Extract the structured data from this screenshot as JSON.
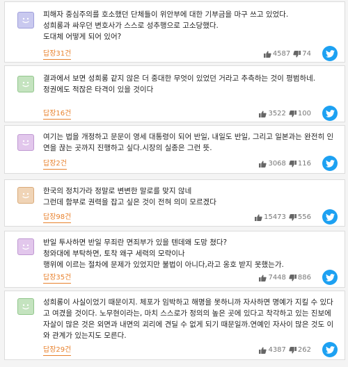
{
  "comments": [
    {
      "text": "피해자 중심주의를 호소했던 단체들이 위안부에 대한 기부금을 마구 쓰고 있었다.\n성희롱과 싸우던 변호사가 스스로 성추행으로 고소당했다.\n도대체 어떻게 되어 있어?",
      "reply": "답장31건",
      "likes": "4587",
      "dislikes": "74",
      "avatar_color": "#c9c9ef",
      "avatar_border": "#9f9fdb"
    },
    {
      "text": "결과에서 보면 성희롱 같지 않은 더 중대한 무엇이 있었던 거라고 추측하는 것이 평범하네.\n정권에도 적잖은 타격이 있을 것이다",
      "reply": "답장16건",
      "likes": "3522",
      "dislikes": "100",
      "avatar_color": "#c4e3bf",
      "avatar_border": "#92c68c"
    },
    {
      "text": "여기는 법을 개정하고 문문이 영세 대통령이 되어 반일, 내일도 반일, 그리고 일본과는 완전히 인연을 끊는 곳까지 진행하고 싶다.시장의 실종은 그런 뜻.",
      "reply": "답장2건",
      "likes": "3068",
      "dislikes": "116",
      "avatar_color": "#e2c7ec",
      "avatar_border": "#bf98d2"
    },
    {
      "text": "한국의 정치가라 정말로 변변한 말로를 맞지 않네\n그런데 함부로 권력을 잡고 싶은 것이 전혀 의미 모르겠다",
      "reply": "답장98건",
      "likes": "15473",
      "dislikes": "556",
      "avatar_color": "#f0d4b6",
      "avatar_border": "#d9aa79"
    },
    {
      "text": "반일 투사하면 반일 무죄란 면죄부가 있을 텐데왜 도망 쳤다?\n청와대에 부탁하면, 토착 왜구 세력의 모략이나\n행위에 이르는 절차에 문제가 있었지만 불법이 아니다,라고 옹호 받지 못했는가.",
      "reply": "답장35건",
      "likes": "7448",
      "dislikes": "886",
      "avatar_color": "#e2c7ec",
      "avatar_border": "#bf98d2"
    },
    {
      "text": "성희롱이 사실이었기 때문이지. 체포가 임박하고 해명을 못하니까 자사하면 명예가 지킬 수 있다고 여겼을 것이다. 노무현이라는, 마치 스스로가 정의의 높은 곳에 있다고 착각하고 있는 진보에 자살이 많은 것은 외면과 내면의 괴리에 견딜 수 없게 되기 때문일까.연예인 자사이 많은 것도 이와 관계가 있는지도 모른다.",
      "reply": "답장29건",
      "likes": "4387",
      "dislikes": "262",
      "avatar_color": "#c4e3bf",
      "avatar_border": "#92c68c"
    }
  ]
}
